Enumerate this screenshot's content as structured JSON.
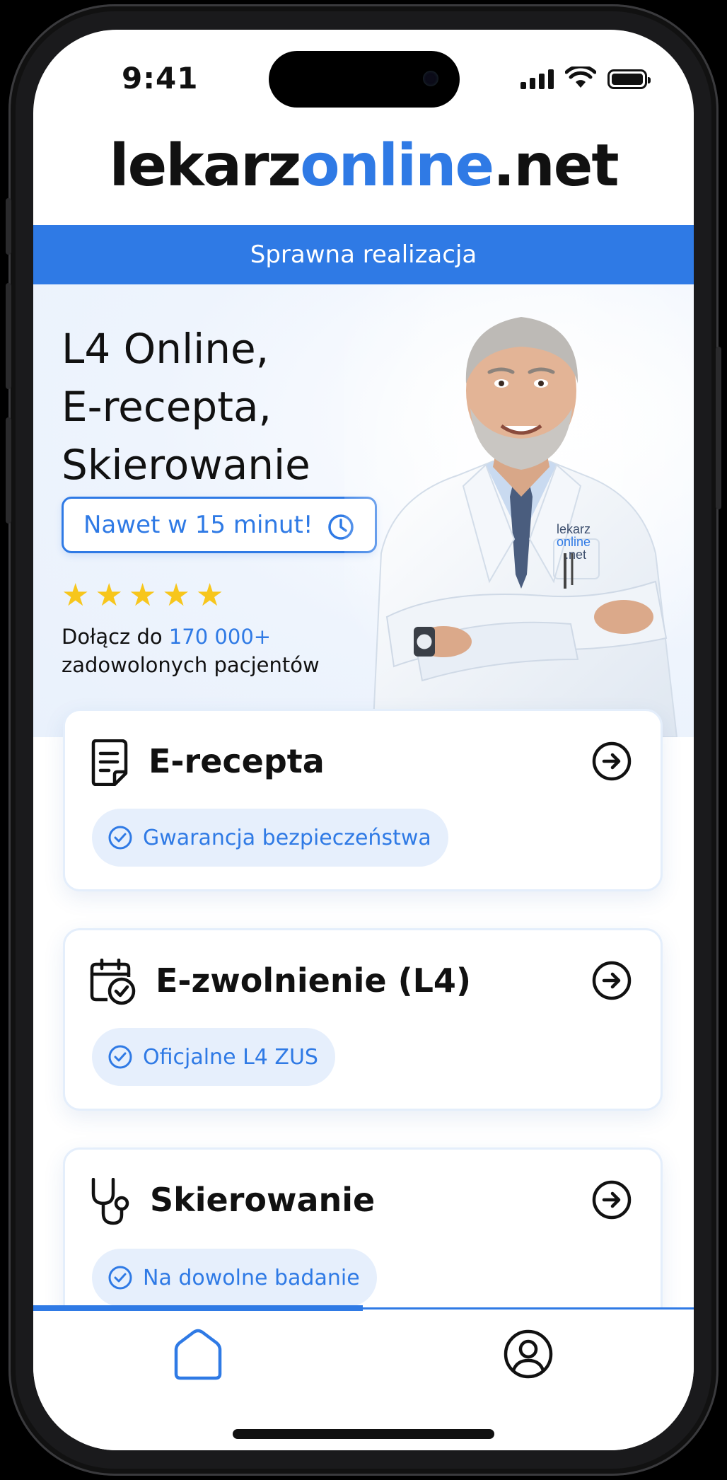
{
  "status": {
    "time": "9:41"
  },
  "logo": {
    "part1": "lekarz",
    "part2": "online",
    "part3": ".net"
  },
  "banner": {
    "text": "Sprawna realizacja"
  },
  "hero": {
    "title_lines": [
      "L4 Online,",
      "E-recepta,",
      "Skierowanie"
    ],
    "badge": "Nawet w 15 minut!",
    "rating_stars": 5,
    "join_prefix": "Dołącz do ",
    "join_count": "170 000+",
    "join_suffix": "zadowolonych pacjentów",
    "coat_logo": [
      "lekarz",
      "online",
      ".net"
    ]
  },
  "cards": [
    {
      "title": "E-recepta",
      "icon": "document-icon",
      "chip": "Gwarancja bezpieczeństwa"
    },
    {
      "title": "E-zwolnienie (L4)",
      "icon": "calendar-check-icon",
      "chip": "Oficjalne L4 ZUS"
    },
    {
      "title": "Skierowanie",
      "icon": "stethoscope-icon",
      "chip": "Na dowolne badanie"
    }
  ],
  "tabbar": {
    "tabs": [
      "home-icon",
      "user-icon"
    ],
    "active": "home-icon"
  },
  "colors": {
    "accent": "#2f7ae5",
    "star": "#f7c61c",
    "chip_bg": "#e6effc"
  }
}
